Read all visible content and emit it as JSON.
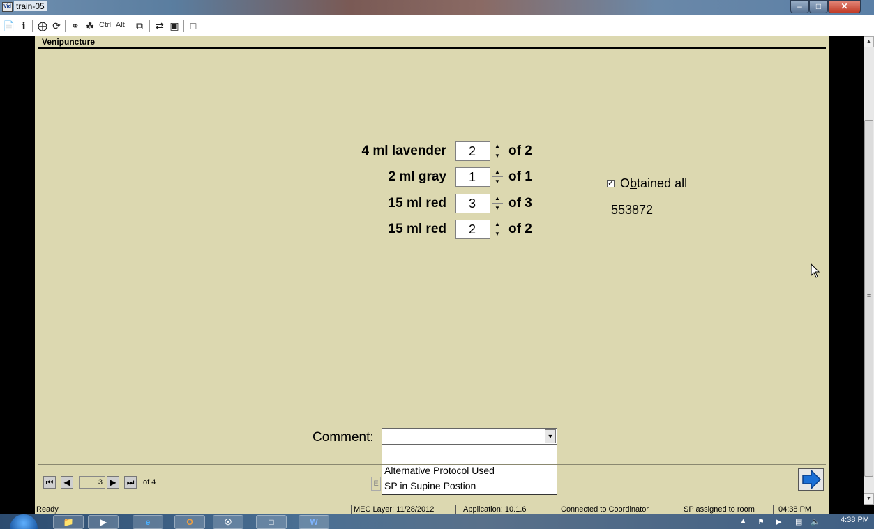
{
  "window": {
    "title": "train-05",
    "app_icon_text": "Vid"
  },
  "toolbar": {
    "ctrl_label": "Ctrl",
    "alt_label": "Alt"
  },
  "panel": {
    "title": "Venipuncture",
    "tubes": [
      {
        "label": "4 ml lavender",
        "value": "2",
        "of": "of 2"
      },
      {
        "label": "2 ml gray",
        "value": "1",
        "of": "of 1"
      },
      {
        "label": "15 ml red",
        "value": "3",
        "of": "of 3"
      },
      {
        "label": "15 ml red",
        "value": "2",
        "of": "of 2"
      }
    ],
    "obtained_all": {
      "label_pre": "O",
      "label_accel": "b",
      "label_post": "tained all",
      "checked": true
    },
    "id_number": "553872",
    "comment": {
      "label": "Comment:",
      "value": "",
      "options": [
        "Alternative Protocol Used",
        "SP in Supine Postion"
      ]
    },
    "navigation": {
      "record": "3",
      "of": "of 4",
      "hidden_button_label": "E"
    }
  },
  "statusbar": {
    "status": "Ready",
    "mec_layer": "MEC Layer: 11/28/2012",
    "application": "Application: 10.1.6",
    "connection": "Connected to Coordinator",
    "sp_status": "SP assigned to room",
    "time": "04:38 PM"
  },
  "taskbar": {
    "clock": "4:38 PM",
    "apps": [
      "explorer",
      "media",
      "internet-explorer",
      "outlook",
      "tech",
      "blank",
      "word"
    ]
  },
  "colors": {
    "panel_bg": "#dcd8b0",
    "next_arrow": "#1a6fd6"
  }
}
